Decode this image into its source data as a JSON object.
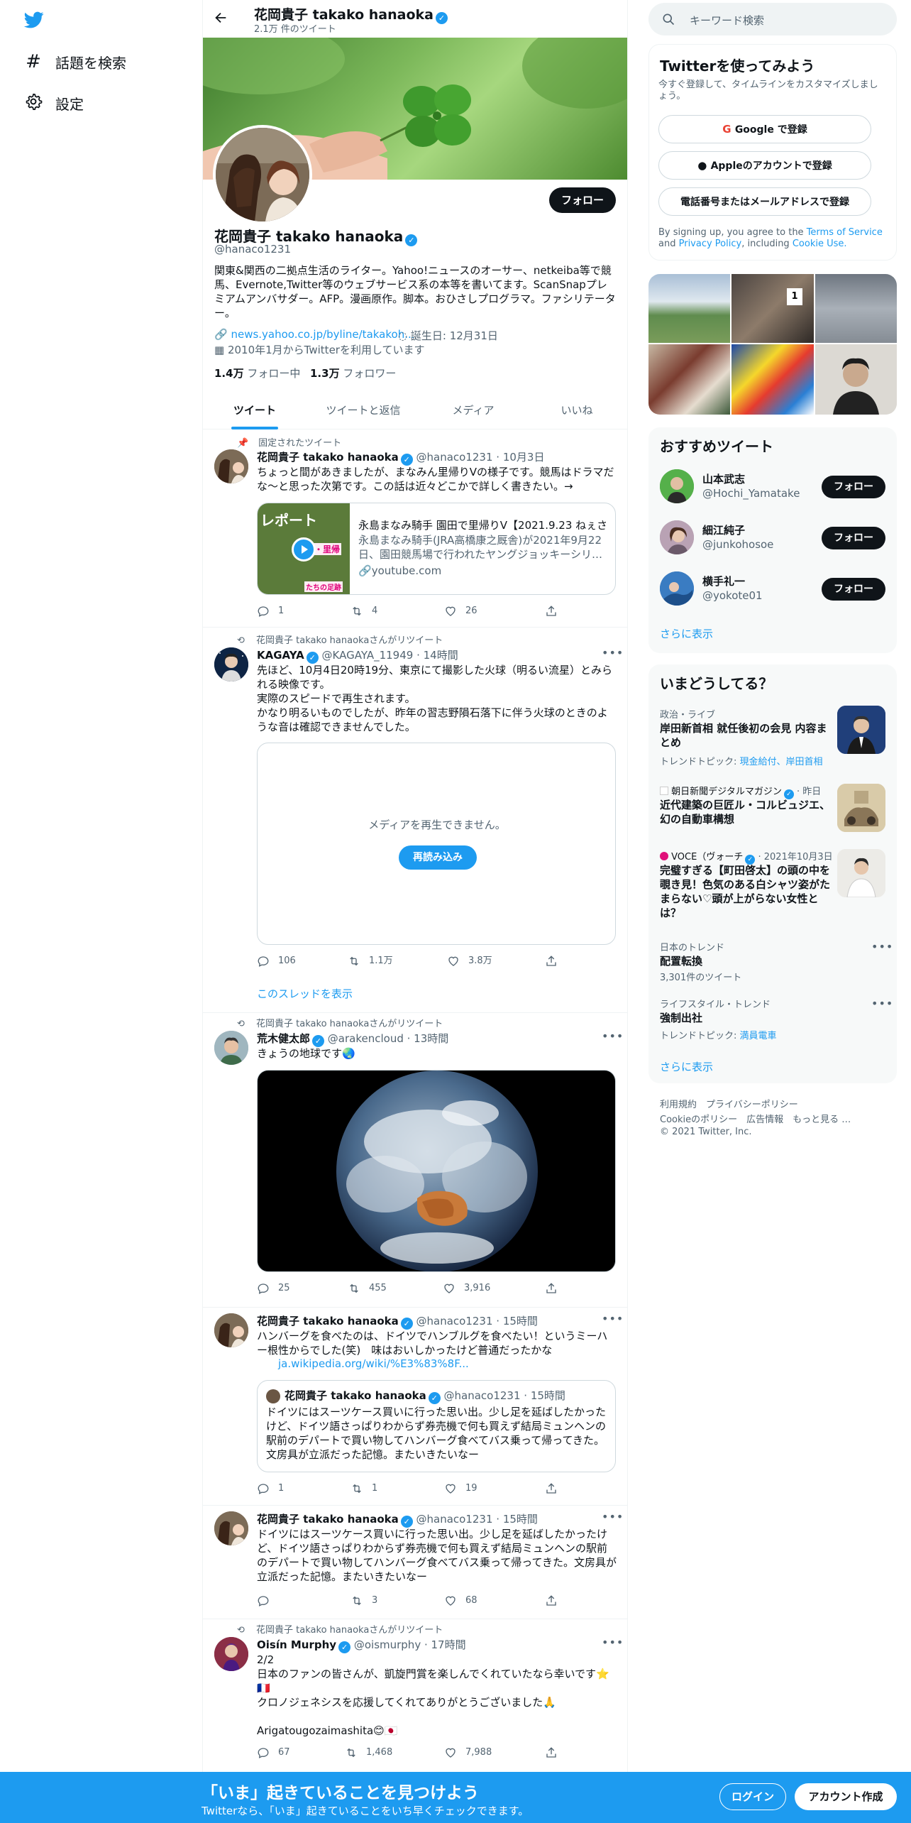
{
  "left_nav": {
    "explore_label": "話題を検索",
    "settings_label": "設定"
  },
  "profile_header": {
    "name": "花岡貴子 takako hanaoka",
    "tweet_count": "2.1万 件のツイート"
  },
  "profile": {
    "name": "花岡貴子 takako hanaoka",
    "handle": "@hanaco1231",
    "follow_label": "フォロー",
    "bio": "関東&関西の二拠点生活のライター。Yahoo!ニュースのオーサー、netkeiba等で競馬、Evernote,Twitter等のウェブサービス系の本等を書いてます。ScanSnapプレミアムアンバサダー。AFP。漫画原作。脚本。おひさしプログラマ。ファシリテーター。",
    "link": "news.yahoo.co.jp/byline/takakoh...",
    "birthday": "誕生日: 12月31日",
    "joined": "2010年1月からTwitterを利用しています",
    "following_count": "1.4万",
    "following_label": "フォロー中",
    "followers_count": "1.3万",
    "followers_label": "フォロワー"
  },
  "tabs": [
    "ツイート",
    "ツイートと返信",
    "メディア",
    "いいね"
  ],
  "tweets": [
    {
      "context": "固定されたツイート",
      "name": "花岡貴子 takako hanaoka",
      "handle": "@hanaco1231",
      "time": "10月3日",
      "text": "ちょっと間があきましたが、まなみん里帰りVの様子です。競馬はドラマだな～と思った次第です。この話は近々どこかで詳しく書きたい。→",
      "card": {
        "title": "永島まなみ騎手 園田で里帰りV【2021.9.23 ねぇさ…",
        "desc": "永島まなみ騎手(JRA高橋康之厩舎)が2021年9月22日、園田競馬場で行われたヤングジョッキーシリ…",
        "domain": "youtube.com",
        "thumb_text": "レポート",
        "thumb_sub": "祝・里帰",
        "thumb_sub2": "たちの足跡"
      },
      "replies": "1",
      "retweets": "4",
      "likes": "26"
    },
    {
      "context": "花岡貴子 takako hanaokaさんがリツイート",
      "name": "KAGAYA",
      "handle": "@KAGAYA_11949",
      "time": "14時間",
      "text": "先ほど、10月4日20時19分、東京にて撮影した火球（明るい流星）とみられる映像です。\n実際のスピードで再生されます。\nかなり明るいものでしたが、昨年の習志野隕石落下に伴う火球のときのような音は確認できませんでした。",
      "media_error": "メディアを再生できません。",
      "reload_label": "再読み込み",
      "replies": "106",
      "retweets": "1.1万",
      "likes": "3.8万",
      "thread_label": "このスレッドを表示"
    },
    {
      "context": "花岡貴子 takako hanaokaさんがリツイート",
      "name": "荒木健太郎",
      "handle": "@arakencloud",
      "time": "13時間",
      "text": "きょうの地球です🌏",
      "replies": "25",
      "retweets": "455",
      "likes": "3,916"
    },
    {
      "name": "花岡貴子 takako hanaoka",
      "handle": "@hanaco1231",
      "time": "15時間",
      "text": "ハンバーグを食べたのは、ドイツでハンブルグを食べたい！というミーハー根性からでした(笑)　味はおいしかったけど普通だったかな",
      "link": "ja.wikipedia.org/wiki/%E3%83%8F...",
      "quote": {
        "name": "花岡貴子 takako hanaoka",
        "handle": "@hanaco1231",
        "time": "15時間",
        "text": "ドイツにはスーツケース買いに行った思い出。少し足を延ばしたかったけど、ドイツ語さっぱりわからず券売機で何も買えず結局ミュンヘンの駅前のデパートで買い物してハンバーグ食べてバス乗って帰ってきた。文房具が立派だった記憶。またいきたいなー"
      },
      "replies": "1",
      "retweets": "1",
      "likes": "19"
    },
    {
      "name": "花岡貴子 takako hanaoka",
      "handle": "@hanaco1231",
      "time": "15時間",
      "text": "ドイツにはスーツケース買いに行った思い出。少し足を延ばしたかったけど、ドイツ語さっぱりわからず券売機で何も買えず結局ミュンヘンの駅前のデパートで買い物してハンバーグ食べてバス乗って帰ってきた。文房具が立派だった記憶。またいきたいなー",
      "replies": "",
      "retweets": "3",
      "likes": "68"
    },
    {
      "context": "花岡貴子 takako hanaokaさんがリツイート",
      "name": "Oisín Murphy",
      "handle": "@oismurphy",
      "time": "17時間",
      "text": "2/2\n日本のファンの皆さんが、凱旋門賞を楽しんでくれていたなら幸いです⭐🇫🇷\nクロノジェネシスを応援してくれてありがとうございました🙏\n\nArigatougozaimashita😊🇯🇵",
      "replies": "67",
      "retweets": "1,468",
      "likes": "7,988"
    }
  ],
  "search": {
    "placeholder": "キーワード検索"
  },
  "signup": {
    "title": "Twitterを使ってみよう",
    "subtitle": "今すぐ登録して、タイムラインをカスタマイズしましょう。",
    "google": "Google で登録",
    "apple": "Appleのアカウントで登録",
    "phone": "電話番号またはメールアドレスで登録",
    "terms_pre": "By signing up, you agree to the",
    "terms": "Terms of Service",
    "and": "and",
    "privacy": "Privacy Policy",
    "including": ", including",
    "cookie": "Cookie Use."
  },
  "recommend": {
    "title": "おすすめツイート",
    "follow_label": "フォロー",
    "more": "さらに表示",
    "users": [
      {
        "name": "山本武志",
        "handle": "@Hochi_Yamatake"
      },
      {
        "name": "細江純子",
        "handle": "@junkohosoe"
      },
      {
        "name": "横手礼一",
        "handle": "@yokote01"
      }
    ]
  },
  "trends": {
    "title": "いまどうしてる？",
    "more": "さらに表示",
    "items": [
      {
        "category": "政治・ライブ",
        "title": "岸田新首相 就任後初の会見 内容まとめ",
        "meta_pre": "トレンドトピック: ",
        "meta_links": "現金給付、岸田首相"
      },
      {
        "category": "朝日新聞デジタルマガジン",
        "time": "昨日",
        "title": "近代建築の巨匠ル・コルビュジエ、幻の自動車構想"
      },
      {
        "category": "VOCE（ヴォーチ",
        "time": "2021年10月3日",
        "title": "完璧すぎる【町田啓太】の頭の中を覗き見！色気のある白シャツ姿がたまらない♡頭が上がらない女性とは？"
      },
      {
        "category": "日本のトレンド",
        "title": "配置転換",
        "meta": "3,301件のツイート"
      },
      {
        "category": "ライフスタイル・トレンド",
        "title": "強制出社",
        "meta_pre": "トレンドトピック: ",
        "meta_links": "満員電車"
      }
    ]
  },
  "footer": {
    "links1": "利用規約　プライバシーポリシー",
    "links2": "Cookieのポリシー　広告情報　もっと見る …",
    "copyright": "© 2021 Twitter, Inc."
  },
  "bottom_bar": {
    "title": "「いま」起きていることを見つけよう",
    "subtitle": "Twitterなら、「いま」起きていることをいち早くチェックできます。",
    "login": "ログイン",
    "signup": "アカウント作成"
  },
  "colors": {
    "accent": "#1d9bf0",
    "bottom_bar": "#1d9bf0",
    "text": "#0f1419",
    "secondary": "#536471"
  }
}
